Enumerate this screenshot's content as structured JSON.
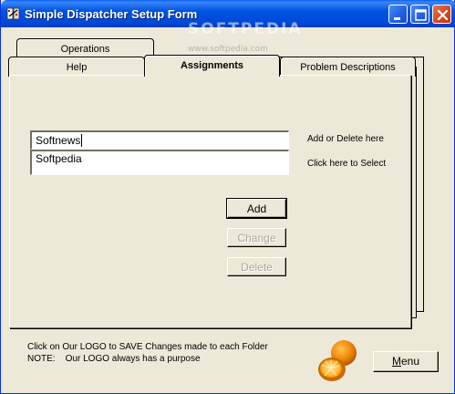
{
  "window": {
    "title": "Simple Dispatcher Setup Form",
    "watermark": "SOFTPEDIA",
    "watermark_url": "www.softpedia.com"
  },
  "tabs": {
    "back_row": [
      {
        "label": "Operations"
      }
    ],
    "front_row": [
      {
        "label": "Help"
      },
      {
        "label": "Assignments",
        "active": true
      },
      {
        "label": "Problem Descriptions"
      }
    ]
  },
  "assignments": {
    "entry_value": "Softnews",
    "entry_hint": "Add or Delete here",
    "list_items": [
      "Softpedia"
    ],
    "list_hint": "Click here to Select",
    "add_label": "Add",
    "change_label": "Change",
    "delete_label": "Delete"
  },
  "footer": {
    "line1": "Click on Our LOGO to SAVE Changes made to each Folder",
    "line2": "NOTE:    Our LOGO always has a purpose",
    "menu_label": "Menu"
  },
  "icons": {
    "app": "dispatcher-app-icon",
    "logo": "orange-logo-icon"
  },
  "colors": {
    "titlebar": "#0054e3",
    "close_button": "#d6451f",
    "face": "#ece9d8",
    "disabled_text": "#aca899"
  }
}
